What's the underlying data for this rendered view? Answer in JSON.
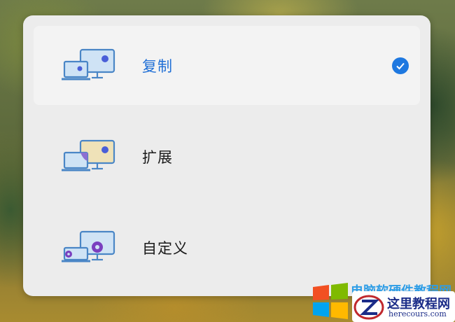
{
  "options": [
    {
      "label": "复制",
      "selected": true,
      "icon": "duplicate-display-icon"
    },
    {
      "label": "扩展",
      "selected": false,
      "icon": "extend-display-icon"
    },
    {
      "label": "自定义",
      "selected": false,
      "icon": "custom-display-icon"
    }
  ],
  "colors": {
    "accent": "#1e78e0",
    "selected_label": "#1f6fd6",
    "panel_bg": "#ececec"
  },
  "watermark": {
    "line1": "电脑软硬件教程网",
    "site_cn": "这里教程网",
    "site_en": "herecours.com"
  }
}
